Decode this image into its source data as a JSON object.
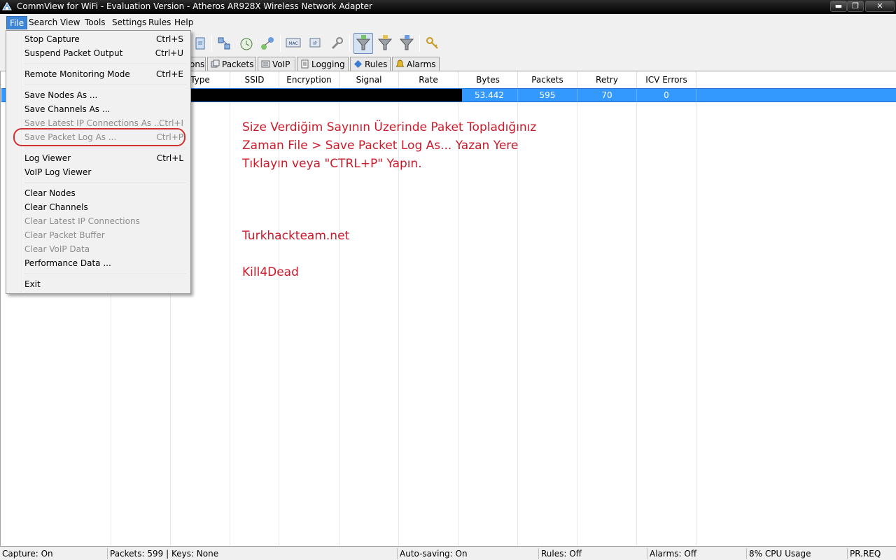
{
  "window": {
    "title": "CommView for WiFi - Evaluation Version - Atheros AR928X Wireless Network Adapter",
    "min_glyph": "▬",
    "max_glyph": "❐",
    "close_glyph": "✕"
  },
  "menubar": [
    "File",
    "Search",
    "View",
    "Tools",
    "Settings",
    "Rules",
    "Help"
  ],
  "tabs": [
    {
      "label": "ons"
    },
    {
      "label": "Packets",
      "icon": "packets-icon"
    },
    {
      "label": "VoIP",
      "icon": "voip-icon"
    },
    {
      "label": "Logging",
      "icon": "logging-icon"
    },
    {
      "label": "Rules",
      "icon": "rules-icon"
    },
    {
      "label": "Alarms",
      "icon": "alarms-icon"
    }
  ],
  "grid": {
    "columns": [
      "Type",
      "SSID",
      "Encryption",
      "Signal",
      "Rate",
      "Bytes",
      "Packets",
      "Retry",
      "ICV Errors"
    ],
    "selected_row": {
      "bytes": "53.442",
      "packets": "595",
      "retry": "70",
      "icv_errors": "0"
    }
  },
  "file_menu": {
    "items": [
      {
        "label": "Stop Capture",
        "shortcut": "Ctrl+S"
      },
      {
        "label": "Suspend Packet Output",
        "shortcut": "Ctrl+U"
      },
      {
        "label": "Remote Monitoring Mode",
        "shortcut": "Ctrl+E"
      },
      {
        "label": "Save Nodes As ...",
        "shortcut": ""
      },
      {
        "label": "Save Channels As ...",
        "shortcut": ""
      },
      {
        "label": "Save Latest IP Connections As ...",
        "shortcut": "Ctrl+I",
        "disabled": true
      },
      {
        "label": "Save Packet Log As ...",
        "shortcut": "Ctrl+P",
        "disabled": true
      },
      {
        "label": "Log Viewer",
        "shortcut": "Ctrl+L"
      },
      {
        "label": "VoIP Log Viewer",
        "shortcut": ""
      },
      {
        "label": "Clear Nodes",
        "shortcut": ""
      },
      {
        "label": "Clear Channels",
        "shortcut": ""
      },
      {
        "label": "Clear Latest IP Connections",
        "shortcut": "",
        "disabled": true
      },
      {
        "label": "Clear Packet Buffer",
        "shortcut": "",
        "disabled": true
      },
      {
        "label": "Clear VoIP Data",
        "shortcut": "",
        "disabled": true
      },
      {
        "label": "Performance Data ...",
        "shortcut": ""
      },
      {
        "label": "Exit",
        "shortcut": ""
      }
    ]
  },
  "annotations": {
    "line1": "Size Verdiğim Sayının Üzerinde Paket Topladığınız",
    "line2": "Zaman File > Save Packet Log As... Yazan Yere",
    "line3": "Tıklayın veya \"CTRL+P\" Yapın.",
    "site": "Turkhackteam.net",
    "author": "Kill4Dead",
    "color": "#cc1a2a"
  },
  "statusbar": {
    "capture": "Capture: On",
    "packets_keys": "Packets: 599 | Keys: None",
    "autosaving": "Auto-saving: On",
    "rules": "Rules: Off",
    "alarms": "Alarms: Off",
    "cpu": "8% CPU Usage",
    "last": "PR.REQ"
  },
  "colors": {
    "selection": "#3399ff",
    "menu_active": "#3e87d8",
    "oval": "#d03030"
  }
}
